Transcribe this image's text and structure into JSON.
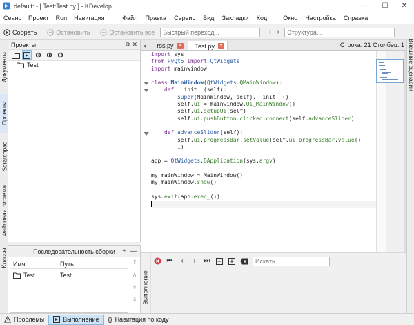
{
  "window": {
    "title": "default:  - [ Test:Test.py ] - KDevelop",
    "controls": {
      "minimize": "—",
      "maximize": "☐",
      "close": "✕"
    }
  },
  "menu": {
    "left": [
      "Сеанс",
      "Проект",
      "Run",
      "Навигация"
    ],
    "right": [
      "Файл",
      "Правка",
      "Сервис",
      "Вид",
      "Закладки",
      "Код",
      "Окно",
      "Настройка",
      "Справка"
    ],
    "overflow": "Код"
  },
  "toolbar": {
    "build": "Собрать",
    "stop": "Остановить",
    "stop_all": "Остановить все",
    "quick_nav_placeholder": "Быстрый переход...",
    "structure_placeholder": "Структура..."
  },
  "left_dock": {
    "tabs": [
      "Документы",
      "Проекты",
      "Scratchpad",
      "Файловая система",
      "Классы"
    ]
  },
  "projects": {
    "title": "Проекты",
    "tree": [
      {
        "label": "Test"
      }
    ]
  },
  "build_sequence": {
    "title": "Последовательность сборки",
    "columns": {
      "name": "Имя",
      "path": "Путь"
    },
    "rows": [
      {
        "name": "Test",
        "path": "Test"
      }
    ]
  },
  "editor": {
    "tabs": [
      {
        "label": "rss.py",
        "active": false
      },
      {
        "label": "Test.py",
        "active": true
      }
    ],
    "cursor_position": "Строка: 21 Столбец: 1",
    "lines": [
      "import sys",
      "from PyQt5 import QtWidgets",
      "import mainwindow",
      "",
      "class MainWindow(QtWidgets.QMainWindow):",
      "    def   init  (self):",
      "        super(MainWindow, self).__init__()",
      "        self.ui = mainwindow.Ui_MainWindow()",
      "        self.ui.setupUi(self)",
      "        self.ui.pushButton.clicked.connect(self.advanceSlider)",
      "",
      "    def advanceSlider(self):",
      "        self.ui.progressBar.setValue(self.ui.progressBar.value() +",
      "        1)",
      "",
      "app = QtWidgets.QApplication(sys.argv)",
      "",
      "my_mainWindow = MainWindow()",
      "my_mainWindow.show()",
      "",
      "sys.exit(app.exec_())",
      ""
    ]
  },
  "right_dock": {
    "tabs": [
      "Внешние сценарии"
    ]
  },
  "output": {
    "side_label": "Выполнение",
    "search_placeholder": "Искать..."
  },
  "statusbar": {
    "items": [
      {
        "label": "Проблемы",
        "active": false
      },
      {
        "label": "Выполнение",
        "active": true
      },
      {
        "label": "Навигация по коду",
        "active": false
      }
    ]
  },
  "colors": {
    "keyword": "#7a2d8f",
    "class": "#2c5fa7",
    "member": "#3a7c2b",
    "number": "#b5641a",
    "accent": "#cde4f7",
    "close_tab": "#e06c55"
  }
}
